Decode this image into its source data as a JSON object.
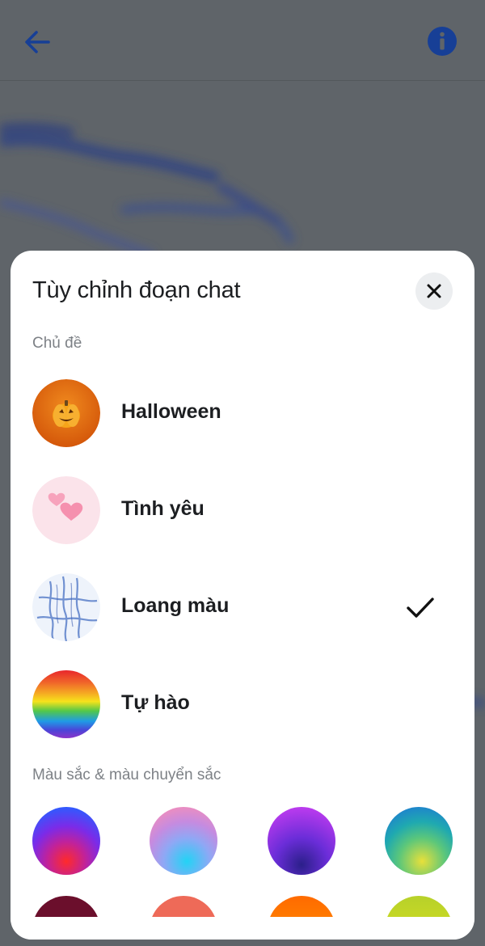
{
  "header": {
    "back_icon": "arrow-left-icon",
    "info_icon": "info-icon",
    "accent_color": "#1446a8"
  },
  "sheet": {
    "title": "Tùy chỉnh đoạn chat",
    "close_icon": "close-icon",
    "themes_label": "Chủ đề",
    "themes": [
      {
        "name": "Halloween",
        "icon": "pumpkin-icon",
        "selected": false
      },
      {
        "name": "Tình yêu",
        "icon": "hearts-icon",
        "selected": false
      },
      {
        "name": "Loang màu",
        "icon": "tie-dye-icon",
        "selected": true
      },
      {
        "name": "Tự hào",
        "icon": "rainbow-icon",
        "selected": false
      }
    ],
    "colors_label": "Màu sắc & màu chuyển sắc",
    "color_swatches": [
      {
        "name": "blue-violet-red",
        "colors": [
          "#2f5bff",
          "#8a2be2",
          "#ff2a2a"
        ]
      },
      {
        "name": "pink-cyan",
        "colors": [
          "#ff7eb3",
          "#b48bf2",
          "#22d3f5"
        ]
      },
      {
        "name": "purple-indigo",
        "colors": [
          "#c93cf0",
          "#7b2ff7",
          "#2b1f8a"
        ]
      },
      {
        "name": "teal-lime",
        "colors": [
          "#1e7be0",
          "#1fb5a8",
          "#c6e03a"
        ]
      },
      {
        "name": "maroon",
        "colors": [
          "#7a1230",
          "#5a0c24"
        ]
      },
      {
        "name": "coral",
        "colors": [
          "#f0705e",
          "#e45d4c"
        ]
      },
      {
        "name": "orange",
        "colors": [
          "#ff7a00",
          "#ffa000"
        ]
      },
      {
        "name": "yellow-green",
        "colors": [
          "#c8d62a",
          "#e0e000"
        ]
      }
    ],
    "check_icon": "checkmark-icon"
  }
}
